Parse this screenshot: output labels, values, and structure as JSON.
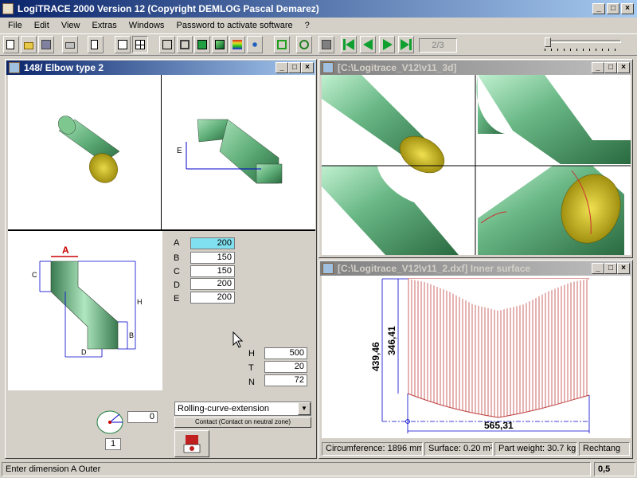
{
  "app": {
    "title": "LogiTRACE 2000  Version 12  (Copyright DEMLOG Pascal Demarez)"
  },
  "menu": [
    "File",
    "Edit",
    "View",
    "Extras",
    "Windows",
    "Password to activate software",
    "?"
  ],
  "toolbar": {
    "page_indicator": "2/3",
    "icons": [
      "new-file-icon",
      "open-folder-icon",
      "save-icon",
      "print-icon",
      "copy-icon",
      "single-view-icon",
      "four-view-icon",
      "wireframe-cube-icon",
      "outline-cube-icon",
      "solid-cube-icon",
      "shaded-cube-icon",
      "rainbow-icon",
      "tree-icon",
      "frame-icon",
      "circle-tool-icon",
      "info-icon",
      "first-icon",
      "previous-icon",
      "next-icon",
      "last-icon"
    ]
  },
  "windows": {
    "elbow": {
      "title": "148/ Elbow type 2"
    },
    "view3d": {
      "title": "[C:\\Logitrace_V12\\v11_3d]"
    },
    "dxf": {
      "title": "[C:\\Logitrace_V12\\v11_2.dxf]  Inner surface"
    }
  },
  "dimensions": [
    {
      "label": "A",
      "value": "200"
    },
    {
      "label": "B",
      "value": "150"
    },
    {
      "label": "C",
      "value": "150"
    },
    {
      "label": "D",
      "value": "200"
    },
    {
      "label": "E",
      "value": "200"
    }
  ],
  "dimensions2": [
    {
      "label": "H",
      "value": "500"
    },
    {
      "label": "T",
      "value": "20"
    },
    {
      "label": "N",
      "value": "72"
    }
  ],
  "drawing_labels": {
    "a": "A",
    "b": "B",
    "c": "C",
    "d": "D",
    "e": "E",
    "h": "H"
  },
  "angle": {
    "value": "0",
    "index": "1"
  },
  "method": {
    "selected": "Rolling-curve-extension",
    "button": "Contact (Contact on neutral zone)"
  },
  "unrolled": {
    "width": "565,31",
    "height1": "439,46",
    "height2": "346,41"
  },
  "dxf_status": [
    "Circumference: 1896 mm",
    "Surface: 0.20 m²",
    "Part weight: 30.7 kg",
    "Rechtang"
  ],
  "status": {
    "message": "Enter dimension A Outer",
    "value": "0,5"
  },
  "colors": {
    "pipe": "#5fae78",
    "cap": "#c8b428",
    "title_active": "#0a246a",
    "dim_red": "#cc0000",
    "hatch": "#c04040"
  }
}
